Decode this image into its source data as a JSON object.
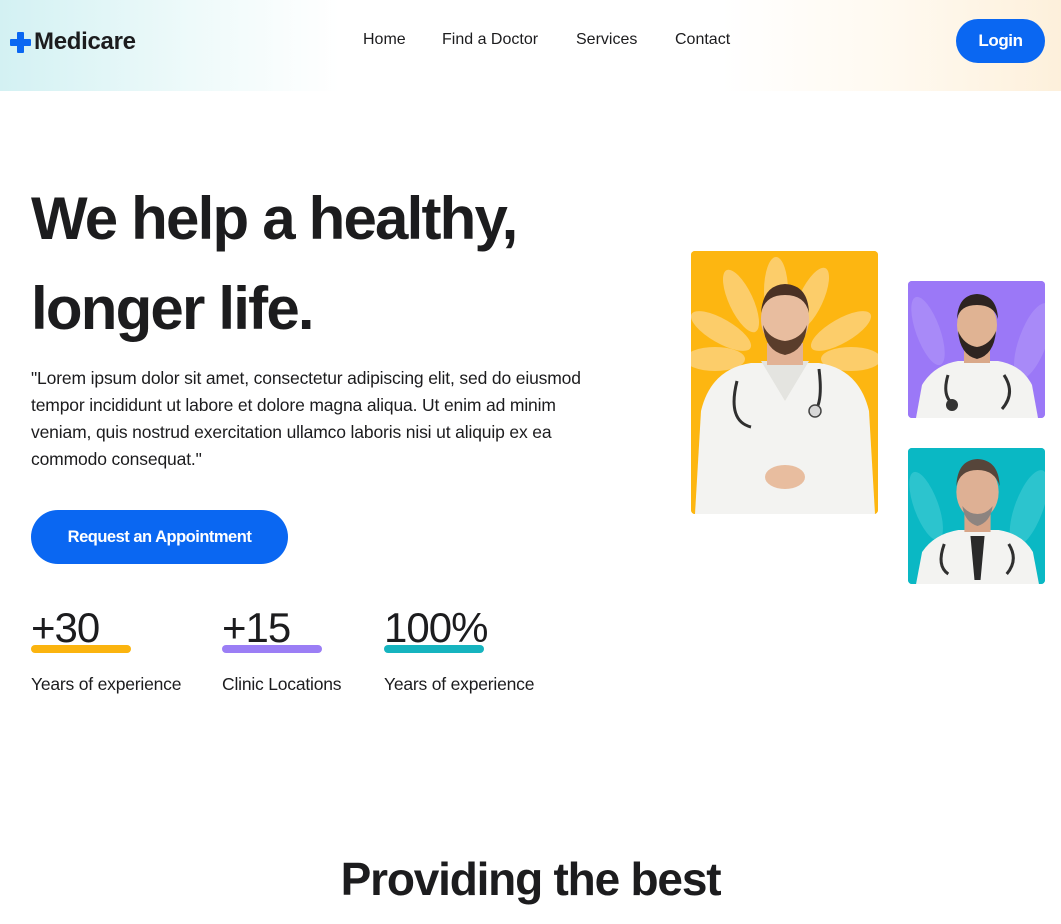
{
  "brand": {
    "name": "Medicare",
    "icon": "plus-icon",
    "accent_color": "#0a67f2"
  },
  "nav": {
    "items": [
      {
        "label": "Home"
      },
      {
        "label": "Find a Doctor"
      },
      {
        "label": "Services"
      },
      {
        "label": "Contact"
      }
    ],
    "login_label": "Login"
  },
  "hero": {
    "title_line1": "We help a healthy,",
    "title_line2": "longer life.",
    "description": "\"Lorem ipsum dolor sit amet, consectetur adipiscing elit, sed do eiusmod tempor incididunt ut labore et dolore magna aliqua. Ut enim ad minim veniam, quis nostrud exercitation ullamco laboris nisi ut aliquip ex ea commodo consequat.\"",
    "cta_label": "Request an Appointment"
  },
  "stats": [
    {
      "value": "+30",
      "label": "Years of experience",
      "color": "#fbb40f"
    },
    {
      "value": "+15",
      "label": "Clinic Locations",
      "color": "#9b7ef5"
    },
    {
      "value": "100%",
      "label": "Years of experience",
      "color": "#16b4bf"
    }
  ],
  "doctors": [
    {
      "photo": "doctor-photo",
      "background": "#fdb611"
    },
    {
      "photo": "doctor-photo",
      "background": "#9b78f7"
    },
    {
      "photo": "doctor-photo",
      "background": "#0ab8c4"
    }
  ],
  "section": {
    "title": "Providing the best"
  }
}
